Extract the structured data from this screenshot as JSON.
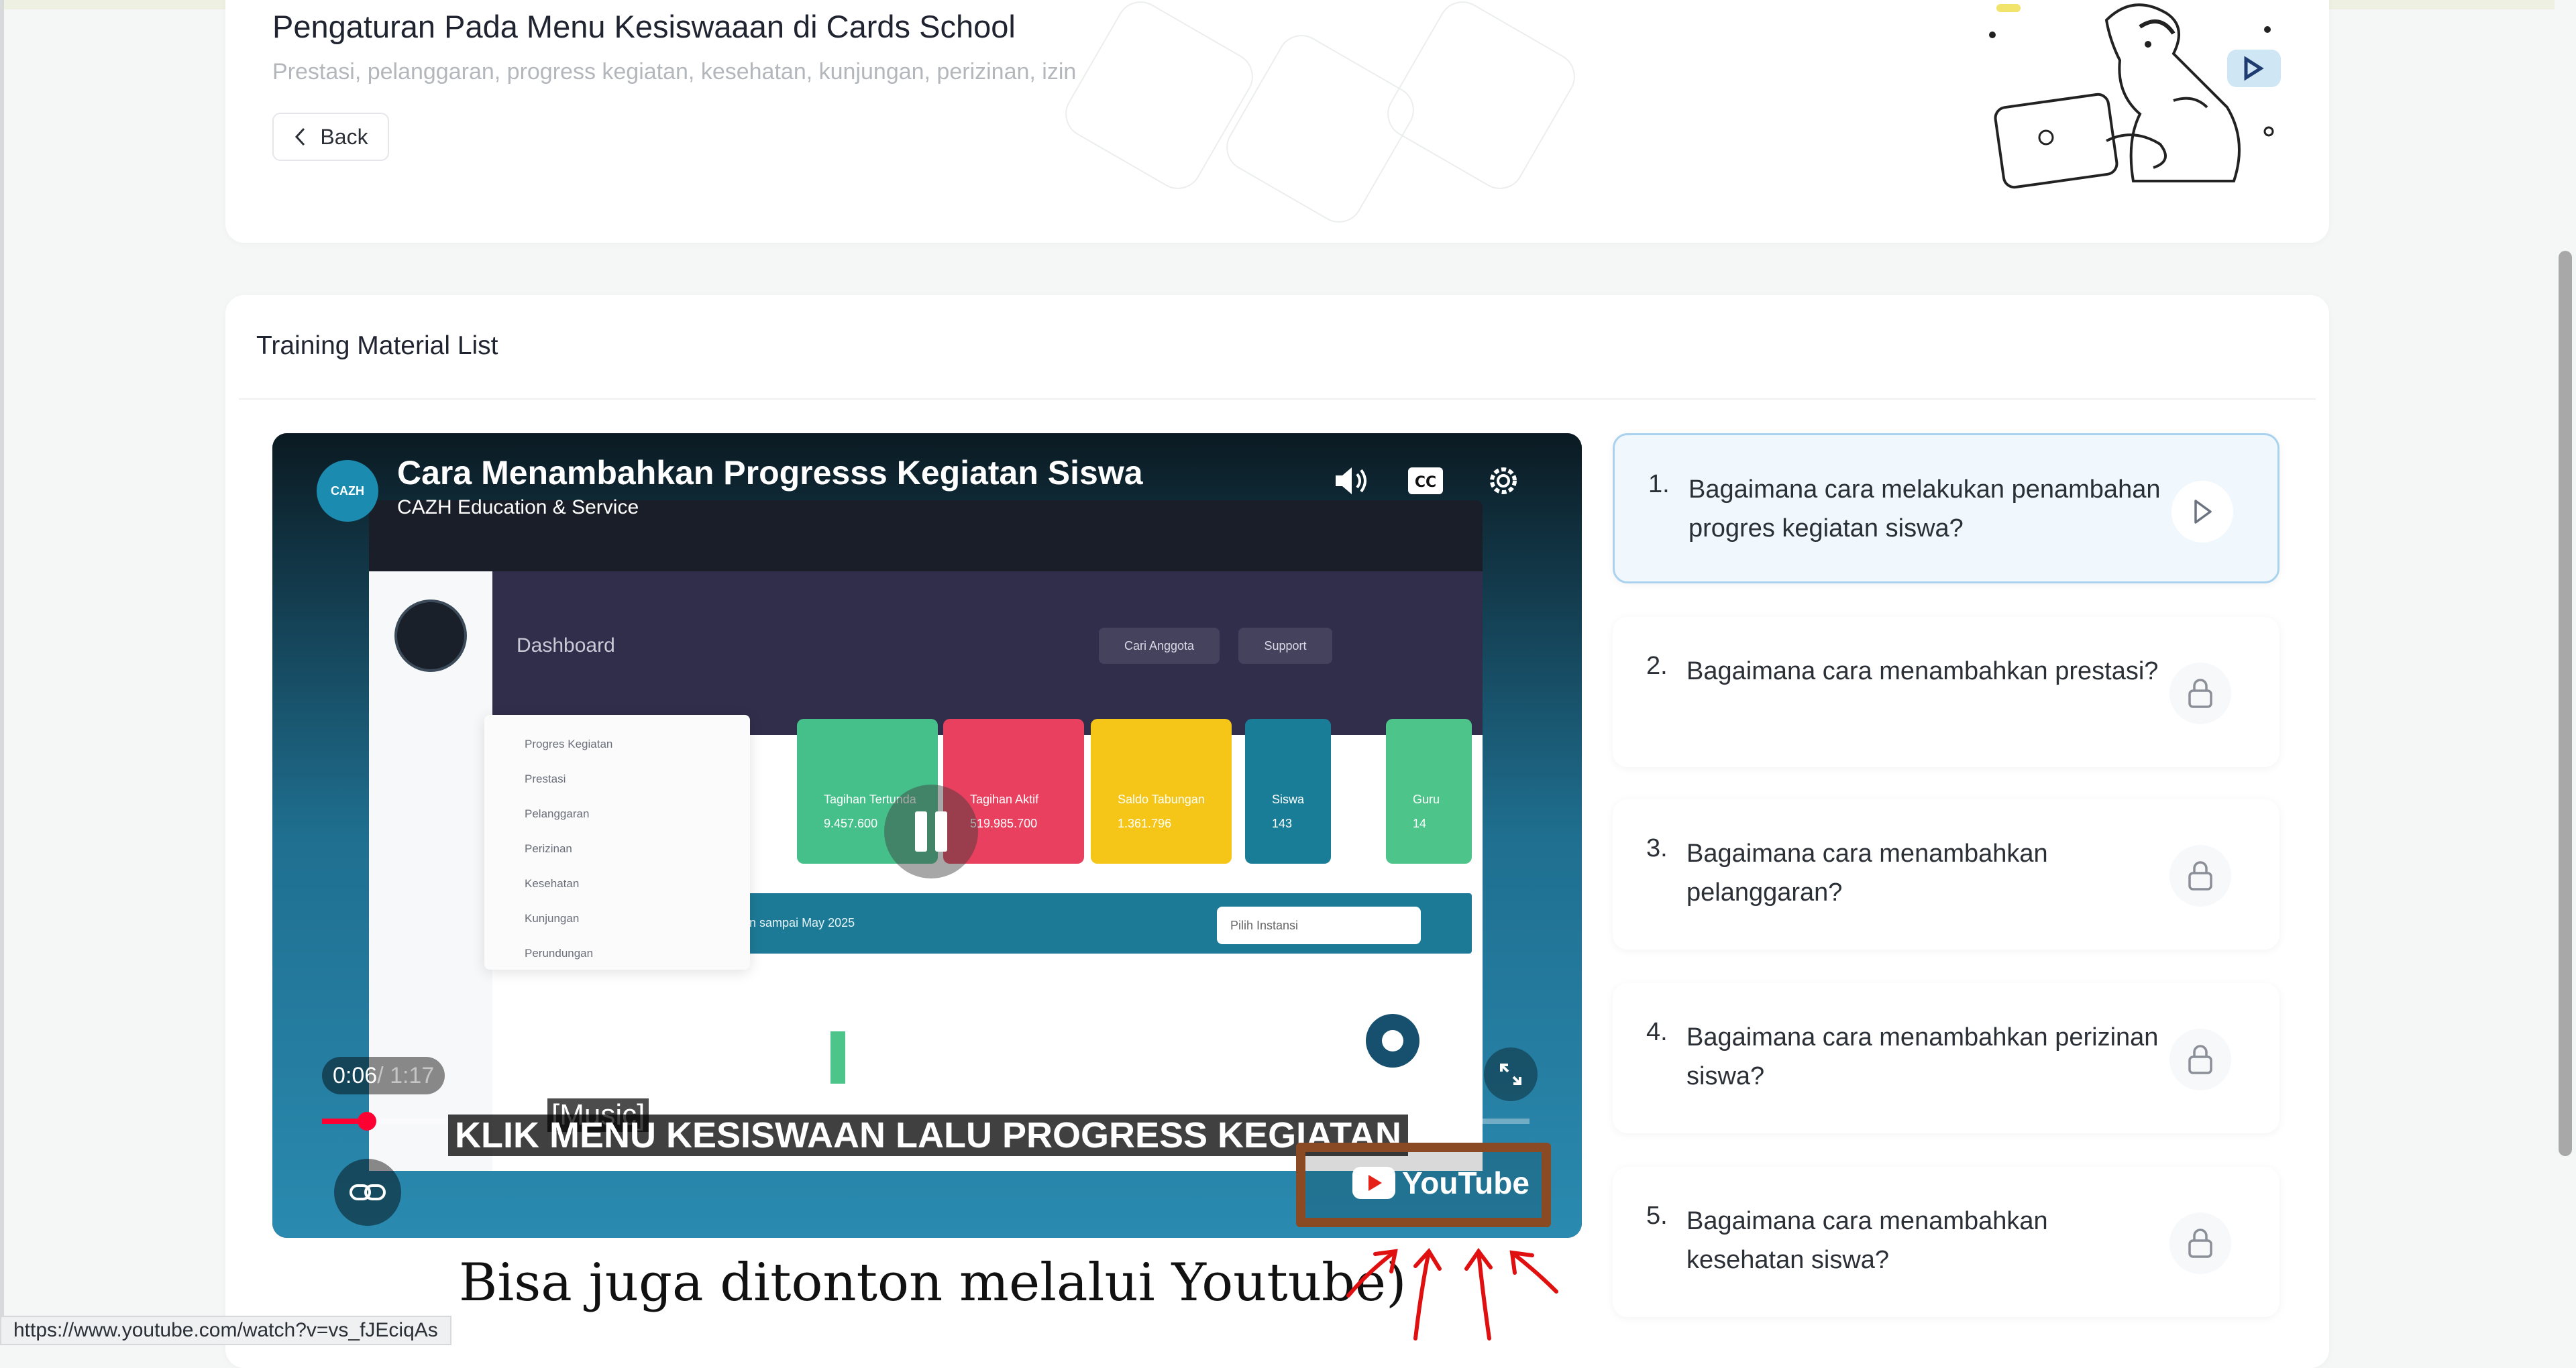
{
  "header": {
    "title": "Pengaturan Pada Menu Kesiswaaan di Cards School",
    "subtitle": "Prestasi, pelanggaran, progress kegiatan, kesehatan, kunjungan, perizinan, izin",
    "back_label": "Back"
  },
  "training": {
    "section_title": "Training Material List",
    "items": [
      {
        "num": "1.",
        "text": "Bagaimana cara melakukan penambahan progres kegiatan siswa?",
        "state": "play"
      },
      {
        "num": "2.",
        "text": "Bagaimana cara menambahkan prestasi?",
        "state": "locked"
      },
      {
        "num": "3.",
        "text": "Bagaimana cara menambahkan pelanggaran?",
        "state": "locked"
      },
      {
        "num": "4.",
        "text": "Bagaimana cara menambahkan perizinan siswa?",
        "state": "locked"
      },
      {
        "num": "5.",
        "text": "Bagaimana cara menambahkan kesehatan siswa?",
        "state": "locked"
      }
    ]
  },
  "video": {
    "channel_logo": "CAZH",
    "title": "Cara Menambahkan Progresss Kegiatan Siswa",
    "channel": "CAZH Education & Service",
    "time_current": "0:06",
    "time_total": " / 1:17",
    "progress": 0.037,
    "caption_music": "[Music]",
    "caption": "KLIK MENU KESISWAAN  LALU PROGRESS KEGIATAN",
    "youtube_label": "YouTube",
    "inner": {
      "dashboard_label": "Dashboard",
      "search_chip": "Cari Anggota",
      "support_chip": "Support",
      "select_placeholder": "Pilih Instansi",
      "bar_text": "...han sampai May 2025",
      "stats": [
        {
          "label": "Tagihan Tertunda",
          "value": "9.457.600",
          "color": "#46c08a"
        },
        {
          "label": "Tagihan Aktif",
          "value": "519.985.700",
          "color": "#e8405e"
        },
        {
          "label": "Saldo Tabungan",
          "value": "1.361.796",
          "color": "#f5c518"
        },
        {
          "label": "Siswa",
          "value": "143",
          "color": "#1a7d98"
        },
        {
          "label": "Guru",
          "value": "14",
          "color": "#4dc489"
        }
      ],
      "menu": [
        "Progres Kegiatan",
        "Prestasi",
        "Pelanggaran",
        "Perizinan",
        "Kesehatan",
        "Kunjungan",
        "Perundungan"
      ]
    }
  },
  "annotation": "Bisa juga ditonton melalui Youtube)",
  "status_bar_url": "https://www.youtube.com/watch?v=vs_fJEciqAs",
  "colors": {
    "accent_active_border": "#a9d2ee",
    "active_item_bg": "#f0f7fd",
    "youtube_red": "#ff0033",
    "highlight_box": "#8a4a24",
    "annotation_arrows": "#e01010"
  }
}
